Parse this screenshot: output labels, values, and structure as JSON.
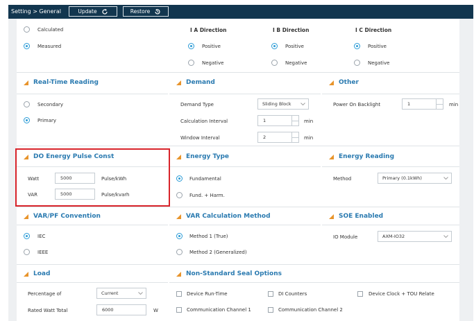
{
  "toolbar": {
    "breadcrumb": "Setting > General",
    "update_label": "Update",
    "restore_label": "Restore"
  },
  "source": {
    "calculated": "Calculated",
    "measured": "Measured",
    "selected": "Measured"
  },
  "directions": [
    {
      "title": "I A Direction",
      "positive": "Positive",
      "negative": "Negative",
      "selected": "Positive"
    },
    {
      "title": "I B Direction",
      "positive": "Positive",
      "negative": "Negative",
      "selected": "Positive"
    },
    {
      "title": "I C Direction",
      "positive": "Positive",
      "negative": "Negative",
      "selected": "Positive"
    }
  ],
  "realtime": {
    "title": "Real-Time Reading",
    "secondary": "Secondary",
    "primary": "Primary",
    "selected": "Primary"
  },
  "demand": {
    "title": "Demand",
    "type_label": "Demand Type",
    "type_value": "Sliding Block",
    "interval_label": "Calculation Interval",
    "interval_value": "1",
    "interval_unit": "min",
    "window_label": "Window Interval",
    "window_value": "2",
    "window_unit": "min"
  },
  "other": {
    "title": "Other",
    "backlight_label": "Power On Backlight",
    "backlight_value": "1",
    "backlight_unit": "min"
  },
  "do_pulse": {
    "title": "DO Energy Pulse Const",
    "watt_label": "Watt",
    "watt_value": "5000",
    "watt_unit": "Pulse/kWh",
    "var_label": "VAR",
    "var_value": "5000",
    "var_unit": "Pulse/kvarh"
  },
  "energy_type": {
    "title": "Energy Type",
    "fundamental": "Fundamental",
    "fund_harm": "Fund. + Harm.",
    "selected": "Fundamental"
  },
  "energy_reading": {
    "title": "Energy Reading",
    "method_label": "Method",
    "method_value": "Primary (0.1kWh)"
  },
  "varpf": {
    "title": "VAR/PF Convention",
    "iec": "IEC",
    "ieee": "IEEE",
    "selected": "IEC"
  },
  "var_calc": {
    "title": "VAR Calculation Method",
    "method1": "Method 1 (True)",
    "method2": "Method 2 (Generalized)",
    "selected": "Method 1 (True)"
  },
  "soe": {
    "title": "SOE Enabled",
    "io_label": "IO Module",
    "io_value": "AXM-IO32"
  },
  "load": {
    "title": "Load",
    "pct_label": "Percentage of",
    "pct_value": "Current",
    "rated_label": "Rated Watt Total",
    "rated_value": "6000",
    "rated_unit": "W"
  },
  "seal": {
    "title": "Non-Standard Seal Options",
    "options": [
      "Device Run-Time",
      "DI Counters",
      "Device Clock + TOU Relate",
      "Communication Channel 1",
      "Communication Channel 2"
    ]
  },
  "colors": {
    "topbar": "#12364f",
    "panel_title": "#2a7ab0",
    "title_marker": "#e8942b",
    "radio_selected": "#2a9bd6",
    "highlight": "#d8232a"
  }
}
